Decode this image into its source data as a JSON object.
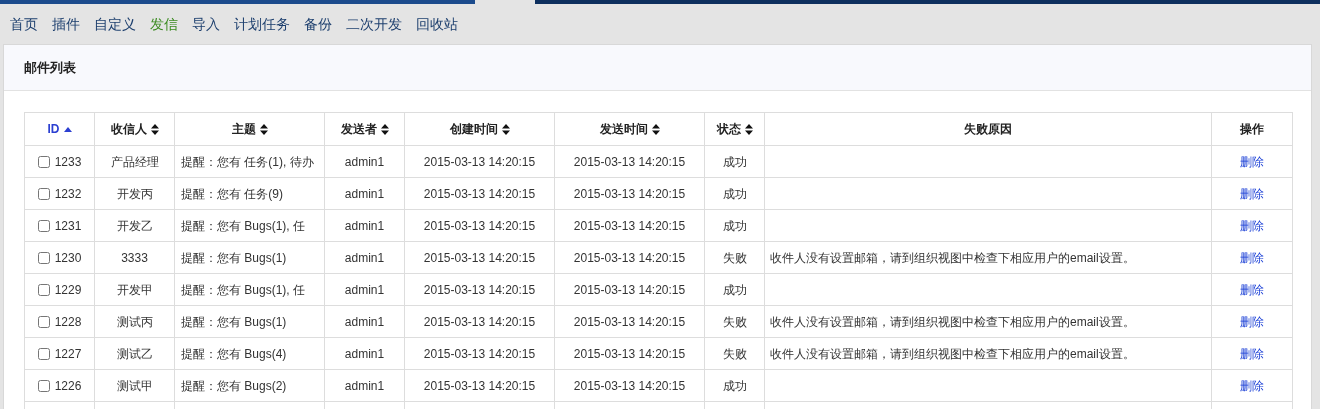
{
  "nav": [
    {
      "label": "首页",
      "selected": false
    },
    {
      "label": "插件",
      "selected": false
    },
    {
      "label": "自定义",
      "selected": false
    },
    {
      "label": "发信",
      "selected": true
    },
    {
      "label": "导入",
      "selected": false
    },
    {
      "label": "计划任务",
      "selected": false
    },
    {
      "label": "备份",
      "selected": false
    },
    {
      "label": "二次开发",
      "selected": false
    },
    {
      "label": "回收站",
      "selected": false
    }
  ],
  "panel": {
    "title": "邮件列表"
  },
  "table": {
    "columns": [
      {
        "label": "ID",
        "sortable": true,
        "selected": true
      },
      {
        "label": "收信人",
        "sortable": true,
        "selected": false
      },
      {
        "label": "主题",
        "sortable": true,
        "selected": false
      },
      {
        "label": "发送者",
        "sortable": true,
        "selected": false
      },
      {
        "label": "创建时间",
        "sortable": true,
        "selected": false
      },
      {
        "label": "发送时间",
        "sortable": true,
        "selected": false
      },
      {
        "label": "状态",
        "sortable": true,
        "selected": false
      },
      {
        "label": "失败原因",
        "sortable": false,
        "selected": false
      },
      {
        "label": "操作",
        "sortable": false,
        "selected": false
      }
    ],
    "rows": [
      {
        "checked": false,
        "id": "1233",
        "to": "产品经理",
        "subject": "提醒：您有 任务(1), 待办",
        "sender": "admin1",
        "created": "2015-03-13 14:20:15",
        "sent": "2015-03-13 14:20:15",
        "status": "成功",
        "action": "删除"
      },
      {
        "checked": false,
        "id": "1232",
        "to": "开发丙",
        "subject": "提醒：您有 任务(9)",
        "sender": "admin1",
        "created": "2015-03-13 14:20:15",
        "sent": "2015-03-13 14:20:15",
        "status": "成功",
        "action": "删除"
      },
      {
        "checked": false,
        "id": "1231",
        "to": "开发乙",
        "subject": "提醒：您有 Bugs(1), 任",
        "sender": "admin1",
        "created": "2015-03-13 14:20:15",
        "sent": "2015-03-13 14:20:15",
        "status": "成功",
        "action": "删除"
      },
      {
        "checked": false,
        "id": "1230",
        "to": "3333",
        "subject": "提醒：您有 Bugs(1)",
        "sender": "admin1",
        "created": "2015-03-13 14:20:15",
        "sent": "2015-03-13 14:20:15",
        "status": "失败",
        "reason": "收件人没有设置邮箱，请到组织视图中检查下相应用户的email设置。",
        "action": "删除"
      },
      {
        "checked": false,
        "id": "1229",
        "to": "开发甲",
        "subject": "提醒：您有 Bugs(1), 任",
        "sender": "admin1",
        "created": "2015-03-13 14:20:15",
        "sent": "2015-03-13 14:20:15",
        "status": "成功",
        "action": "删除"
      },
      {
        "checked": false,
        "id": "1228",
        "to": "测试丙",
        "subject": "提醒：您有 Bugs(1)",
        "sender": "admin1",
        "created": "2015-03-13 14:20:15",
        "sent": "2015-03-13 14:20:15",
        "status": "失败",
        "reason": "收件人没有设置邮箱，请到组织视图中检查下相应用户的email设置。",
        "action": "删除"
      },
      {
        "checked": false,
        "id": "1227",
        "to": "测试乙",
        "subject": "提醒：您有 Bugs(4)",
        "sender": "admin1",
        "created": "2015-03-13 14:20:15",
        "sent": "2015-03-13 14:20:15",
        "status": "失败",
        "reason": "收件人没有设置邮箱，请到组织视图中检查下相应用户的email设置。",
        "action": "删除"
      },
      {
        "checked": false,
        "id": "1226",
        "to": "测试甲",
        "subject": "提醒：您有 Bugs(2)",
        "sender": "admin1",
        "created": "2015-03-13 14:20:15",
        "sent": "2015-03-13 14:20:15",
        "status": "成功",
        "action": "删除"
      }
    ]
  }
}
